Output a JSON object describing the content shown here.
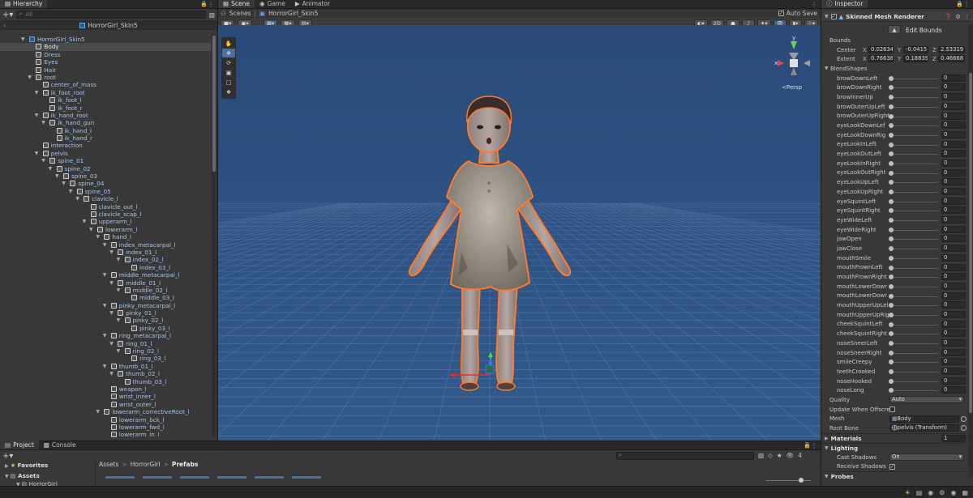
{
  "hierarchy": {
    "tab": "Hierarchy",
    "search_placeholder": "All",
    "scene_name": "HorrorGirl_Skin5",
    "nodes": [
      {
        "label": "HorrorGirl_Skin5",
        "depth": 0,
        "expand": true,
        "prefab": true
      },
      {
        "label": "Body",
        "depth": 1,
        "selected": true
      },
      {
        "label": "Dress",
        "depth": 1
      },
      {
        "label": "Eyes",
        "depth": 1
      },
      {
        "label": "Hair",
        "depth": 1
      },
      {
        "label": "root",
        "depth": 1,
        "expand": true
      },
      {
        "label": "center_of_mass",
        "depth": 2
      },
      {
        "label": "ik_foot_root",
        "depth": 2,
        "expand": true
      },
      {
        "label": "ik_foot_l",
        "depth": 3
      },
      {
        "label": "ik_foot_r",
        "depth": 3
      },
      {
        "label": "ik_hand_root",
        "depth": 2,
        "expand": true
      },
      {
        "label": "ik_hand_gun",
        "depth": 3,
        "expand": true
      },
      {
        "label": "ik_hand_l",
        "depth": 4
      },
      {
        "label": "ik_hand_r",
        "depth": 4
      },
      {
        "label": "interaction",
        "depth": 2
      },
      {
        "label": "pelvis",
        "depth": 2,
        "expand": true
      },
      {
        "label": "spine_01",
        "depth": 3,
        "expand": true
      },
      {
        "label": "spine_02",
        "depth": 4,
        "expand": true
      },
      {
        "label": "spine_03",
        "depth": 5,
        "expand": true
      },
      {
        "label": "spine_04",
        "depth": 6,
        "expand": true
      },
      {
        "label": "spine_05",
        "depth": 7,
        "expand": true
      },
      {
        "label": "clavicle_l",
        "depth": 8,
        "expand": true
      },
      {
        "label": "clavicle_out_l",
        "depth": 9
      },
      {
        "label": "clavicle_scap_l",
        "depth": 9
      },
      {
        "label": "upperarm_l",
        "depth": 9,
        "expand": true
      },
      {
        "label": "lowerarm_l",
        "depth": 10,
        "expand": true
      },
      {
        "label": "hand_l",
        "depth": 11,
        "expand": true
      },
      {
        "label": "index_metacarpal_l",
        "depth": 12,
        "expand": true
      },
      {
        "label": "index_01_l",
        "depth": 13,
        "expand": true
      },
      {
        "label": "index_02_l",
        "depth": 14,
        "expand": true
      },
      {
        "label": "index_03_l",
        "depth": 15
      },
      {
        "label": "middle_metacarpal_l",
        "depth": 12,
        "expand": true
      },
      {
        "label": "middle_01_l",
        "depth": 13,
        "expand": true
      },
      {
        "label": "middle_02_l",
        "depth": 14,
        "expand": true
      },
      {
        "label": "middle_03_l",
        "depth": 15
      },
      {
        "label": "pinky_metacarpal_l",
        "depth": 12,
        "expand": true
      },
      {
        "label": "pinky_01_l",
        "depth": 13,
        "expand": true
      },
      {
        "label": "pinky_02_l",
        "depth": 14,
        "expand": true
      },
      {
        "label": "pinky_03_l",
        "depth": 15
      },
      {
        "label": "ring_metacarpal_l",
        "depth": 12,
        "expand": true
      },
      {
        "label": "ring_01_l",
        "depth": 13,
        "expand": true
      },
      {
        "label": "ring_02_l",
        "depth": 14,
        "expand": true
      },
      {
        "label": "ring_03_l",
        "depth": 15
      },
      {
        "label": "thumb_01_l",
        "depth": 12,
        "expand": true
      },
      {
        "label": "thumb_02_l",
        "depth": 13,
        "expand": true
      },
      {
        "label": "thumb_03_l",
        "depth": 14
      },
      {
        "label": "weapon_l",
        "depth": 12
      },
      {
        "label": "wrist_inner_l",
        "depth": 12
      },
      {
        "label": "wrist_outer_l",
        "depth": 12
      },
      {
        "label": "lowerarm_correctiveRoot_l",
        "depth": 11,
        "expand": true
      },
      {
        "label": "lowerarm_bck_l",
        "depth": 12
      },
      {
        "label": "lowerarm_fwd_l",
        "depth": 12
      },
      {
        "label": "lowerarm_in_l",
        "depth": 12
      }
    ]
  },
  "scene": {
    "tabs": [
      "Scene",
      "Game",
      "Animator"
    ],
    "active_tab": "Scene",
    "breadcrumb_root": "Scenes",
    "breadcrumb_item": "HorrorGirl_Skin5",
    "auto_save_label": "Auto Save",
    "toggle_2d": "2D",
    "persp_label": "Persp",
    "gizmo_y": "y",
    "gizmo_x": "x",
    "tools": [
      "hand",
      "move",
      "rotate",
      "scale",
      "rect",
      "transform"
    ],
    "colors": {
      "sky": "#2a4c7b",
      "grid": "#6f8cb5",
      "outline": "#ff7a2a"
    }
  },
  "inspector": {
    "tab": "Inspector",
    "component": "Skinned Mesh Renderer",
    "edit_bounds": "Edit Bounds",
    "bounds_label": "Bounds",
    "center_label": "Center",
    "center": {
      "x": "0.02634",
      "y": "-0.0415",
      "z": "2.53319"
    },
    "extent_label": "Extent",
    "extent": {
      "x": "0.76638",
      "y": "0.18839",
      "z": "0.46668"
    },
    "blendshapes_label": "BlendShapes",
    "blendshapes": [
      {
        "name": "browDownLeft",
        "value": "0"
      },
      {
        "name": "browDownRight",
        "value": "0"
      },
      {
        "name": "browInnerUp",
        "value": "0"
      },
      {
        "name": "browOuterUpLeft",
        "value": "0"
      },
      {
        "name": "browOuterUpRight",
        "value": "0"
      },
      {
        "name": "eyeLookDownLef",
        "value": "0"
      },
      {
        "name": "eyeLookDownRig",
        "value": "0"
      },
      {
        "name": "eyeLookInLeft",
        "value": "0"
      },
      {
        "name": "eyeLookOutLeft",
        "value": "0"
      },
      {
        "name": "eyeLookInRight",
        "value": "0"
      },
      {
        "name": "eyeLookOutRight",
        "value": "0"
      },
      {
        "name": "eyeLookUpLeft",
        "value": "0"
      },
      {
        "name": "eyeLookUpRight",
        "value": "0"
      },
      {
        "name": "eyeSquintLeft",
        "value": "0"
      },
      {
        "name": "eyeSquintRight",
        "value": "0"
      },
      {
        "name": "eyeWideLeft",
        "value": "0"
      },
      {
        "name": "eyeWideRight",
        "value": "0"
      },
      {
        "name": "jawOpen",
        "value": "0"
      },
      {
        "name": "jawClose",
        "value": "0"
      },
      {
        "name": "mouthSmile",
        "value": "0"
      },
      {
        "name": "mouthFrownLeft",
        "value": "0"
      },
      {
        "name": "mouthFrownRight",
        "value": "0"
      },
      {
        "name": "mouthLowerDowr",
        "value": "0"
      },
      {
        "name": "mouthLowerDowr",
        "value": "0"
      },
      {
        "name": "mouthUpperUpLel",
        "value": "0"
      },
      {
        "name": "mouthUpperUpRig",
        "value": "0"
      },
      {
        "name": "cheekSquintLeft",
        "value": "0"
      },
      {
        "name": "cheekSquintRight",
        "value": "0"
      },
      {
        "name": "noseSneerLeft",
        "value": "0"
      },
      {
        "name": "noseSneerRight",
        "value": "0"
      },
      {
        "name": "smileCreepy",
        "value": "0"
      },
      {
        "name": "teethCrooked",
        "value": "0"
      },
      {
        "name": "noseHooked",
        "value": "0"
      },
      {
        "name": "noseLong",
        "value": "0"
      }
    ],
    "quality_label": "Quality",
    "quality_value": "Auto",
    "update_offscreen_label": "Update When Offscre",
    "mesh_label": "Mesh",
    "mesh_value": "Body",
    "root_bone_label": "Root Bone",
    "root_bone_value": "pelvis (Transform)",
    "materials_label": "Materials",
    "materials_count": "1",
    "lighting_label": "Lighting",
    "cast_shadows_label": "Cast Shadows",
    "cast_shadows_value": "On",
    "receive_shadows_label": "Receive Shadows",
    "probes_label": "Probes"
  },
  "project": {
    "tabs": [
      "Project",
      "Console"
    ],
    "favorites_label": "Favorites",
    "assets_label": "Assets",
    "asset_child": "HorrorGirl",
    "breadcrumb": [
      "Assets",
      "HorrorGirl",
      "Prefabs"
    ],
    "hidden_count": "4"
  }
}
